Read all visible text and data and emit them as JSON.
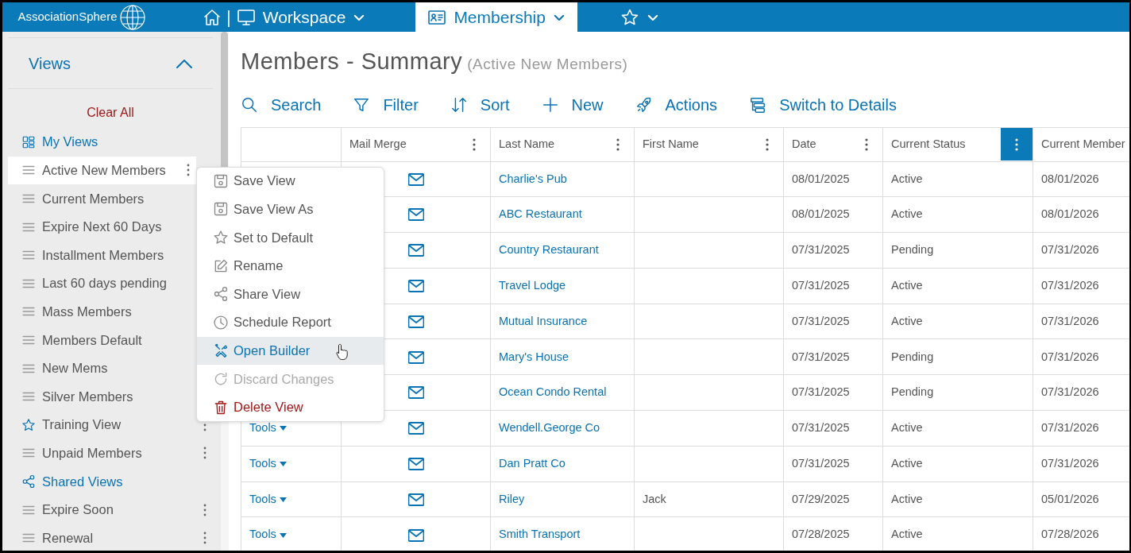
{
  "topbar": {
    "logo": "AssociationSphere",
    "separator": "|",
    "tabs": [
      {
        "label": "Workspace",
        "selected": false
      },
      {
        "label": "Membership",
        "selected": true
      }
    ]
  },
  "sidebar": {
    "title": "Views",
    "expanded": true,
    "clear_all": "Clear All",
    "items": [
      {
        "kind": "section",
        "label": "My Views"
      },
      {
        "kind": "view",
        "label": "Active New Members",
        "selected": true,
        "default": false
      },
      {
        "kind": "view",
        "label": "Current Members",
        "selected": false,
        "default": false
      },
      {
        "kind": "view",
        "label": "Expire Next 60 Days",
        "selected": false,
        "default": false
      },
      {
        "kind": "view",
        "label": "Installment Members",
        "selected": false,
        "default": false
      },
      {
        "kind": "view",
        "label": "Last 60 days pending",
        "selected": false,
        "default": false
      },
      {
        "kind": "view",
        "label": "Mass Members",
        "selected": false,
        "default": false
      },
      {
        "kind": "view",
        "label": "Members Default",
        "selected": false,
        "default": false
      },
      {
        "kind": "view",
        "label": "New Mems",
        "selected": false,
        "default": false
      },
      {
        "kind": "view",
        "label": "Silver Members",
        "selected": false,
        "default": false
      },
      {
        "kind": "view",
        "label": "Training View",
        "selected": false,
        "default": true
      },
      {
        "kind": "view",
        "label": "Unpaid Members",
        "selected": false,
        "default": false
      },
      {
        "kind": "section",
        "label": "Shared Views"
      },
      {
        "kind": "view",
        "label": "Expire Soon",
        "selected": false,
        "default": false
      },
      {
        "kind": "view",
        "label": "Renewal",
        "selected": false,
        "default": false
      }
    ]
  },
  "context_menu": {
    "items": [
      {
        "label": "Save View",
        "kind": "normal",
        "selected": false,
        "disabled": false
      },
      {
        "label": "Save View As",
        "kind": "normal",
        "selected": false,
        "disabled": false
      },
      {
        "label": "Set to Default",
        "kind": "normal",
        "selected": false,
        "disabled": false
      },
      {
        "label": "Rename",
        "kind": "normal",
        "selected": false,
        "disabled": false
      },
      {
        "label": "Share View",
        "kind": "normal",
        "selected": false,
        "disabled": false
      },
      {
        "label": "Schedule Report",
        "kind": "normal",
        "selected": false,
        "disabled": false
      },
      {
        "label": "Open Builder",
        "kind": "normal",
        "selected": true,
        "disabled": false
      },
      {
        "label": "Discard Changes",
        "kind": "normal",
        "selected": false,
        "disabled": true
      },
      {
        "label": "Delete View",
        "kind": "danger",
        "selected": false,
        "disabled": false
      }
    ]
  },
  "page": {
    "title": "Members - Summary",
    "subtitle": "(Active New Members)"
  },
  "toolbar": [
    "Search",
    "Filter",
    "Sort",
    "New",
    "Actions",
    "Switch to Details"
  ],
  "table": {
    "columns": [
      {
        "label": "Mail Merge"
      },
      {
        "label": "Last Name"
      },
      {
        "label": "First Name"
      },
      {
        "label": "Date"
      },
      {
        "label": "Current Status",
        "menu_open": true
      },
      {
        "label": "Current Member"
      }
    ],
    "rows": [
      {
        "last_name": "Charlie's Pub",
        "date": "08/01/2025",
        "status": "Active",
        "current_member": "08/01/2026"
      },
      {
        "last_name": "ABC Restaurant",
        "date": "08/01/2025",
        "status": "Active",
        "current_member": "08/01/2026"
      },
      {
        "last_name": "Country Restaurant",
        "date": "07/31/2025",
        "status": "Pending",
        "current_member": "07/31/2026"
      },
      {
        "last_name": "Travel Lodge",
        "date": "07/31/2025",
        "status": "Active",
        "current_member": "07/31/2026"
      },
      {
        "last_name": "Mutual Insurance",
        "date": "07/31/2025",
        "status": "Active",
        "current_member": "07/31/2026"
      },
      {
        "last_name": "Mary's House",
        "date": "07/31/2025",
        "status": "Pending",
        "current_member": "07/31/2026"
      },
      {
        "last_name": "Ocean Condo Rental",
        "date": "07/31/2025",
        "status": "Pending",
        "current_member": "07/31/2026"
      },
      {
        "tools": "Tools",
        "last_name": "Wendell.George Co",
        "date": "07/31/2025",
        "status": "Active",
        "current_member": "07/31/2026"
      },
      {
        "tools": "Tools",
        "last_name": "Dan Pratt Co",
        "date": "07/31/2025",
        "status": "Active",
        "current_member": "07/31/2026"
      },
      {
        "tools": "Tools",
        "last_name": "Riley",
        "first_name": "Jack",
        "date": "07/29/2025",
        "status": "Active",
        "current_member": "05/01/2026"
      },
      {
        "tools": "Tools",
        "last_name": "Smith Transport",
        "date": "07/28/2025",
        "status": "Active",
        "current_member": "07/28/2026"
      }
    ]
  }
}
